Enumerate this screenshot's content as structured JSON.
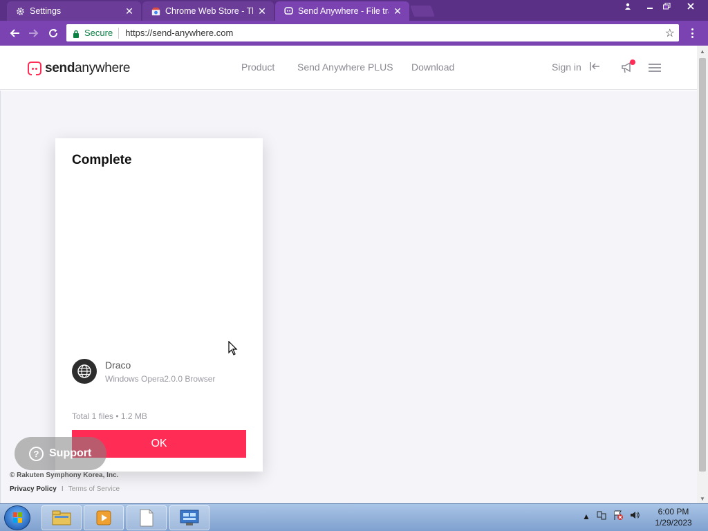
{
  "browser": {
    "tabs": [
      {
        "title": "Settings",
        "icon": "gear-icon",
        "active": false
      },
      {
        "title": "Chrome Web Store - The",
        "icon": "chrome-web-store-icon",
        "active": false
      },
      {
        "title": "Send Anywhere - File tra",
        "icon": "send-anywhere-icon",
        "active": true
      }
    ],
    "close_glyph": "✕",
    "secure_label": "Secure",
    "url": "https://send-anywhere.com",
    "colors": {
      "tabstrip": "#5a2f86",
      "toolbar": "#7a43b1",
      "secure": "#0b8043"
    }
  },
  "site": {
    "logo_prefix": "send",
    "logo_suffix": "anywhere",
    "nav": [
      "Product",
      "Send Anywhere PLUS",
      "Download"
    ],
    "signin_label": "Sign in",
    "accent": "#ff2d55"
  },
  "dialog": {
    "title": "Complete",
    "device_name": "Draco",
    "device_detail": "Windows Opera2.0.0 Browser",
    "summary": "Total 1 files • 1.2 MB",
    "ok_label": "OK"
  },
  "support": {
    "label": "Support",
    "icon": "question-icon"
  },
  "footer": {
    "copyright": "© Rakuten Symphony Korea, Inc.",
    "privacy": "Privacy Policy",
    "separator": "I",
    "terms": "Terms of Service"
  },
  "taskbar": {
    "apps": [
      "file-explorer-icon",
      "media-player-icon",
      "notepad-icon",
      "control-panel-icon"
    ],
    "time": "6:00 PM",
    "date": "1/29/2023"
  }
}
